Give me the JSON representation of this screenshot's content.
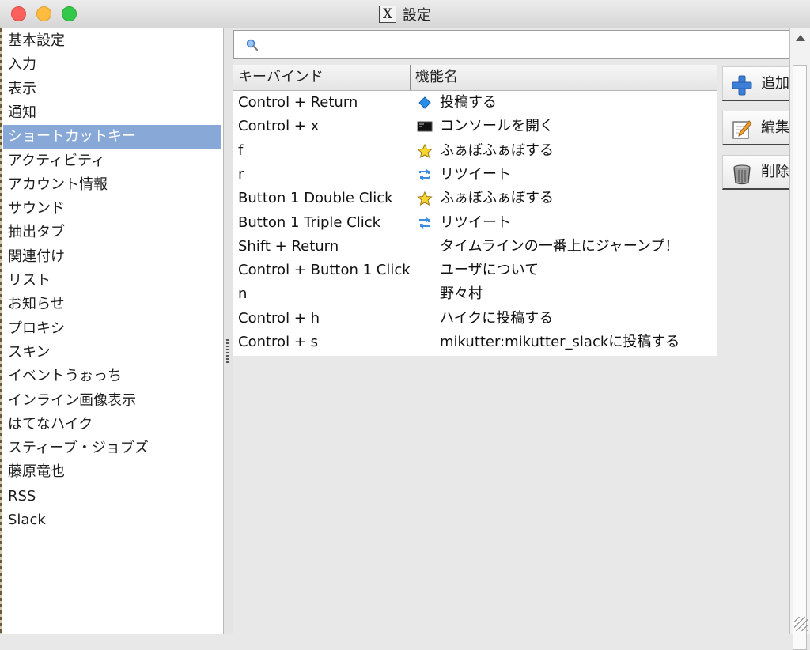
{
  "window": {
    "title": "設定"
  },
  "sidebar": {
    "items": [
      {
        "label": "基本設定"
      },
      {
        "label": "入力"
      },
      {
        "label": "表示"
      },
      {
        "label": "通知"
      },
      {
        "label": "ショートカットキー",
        "selected": true
      },
      {
        "label": "アクティビティ"
      },
      {
        "label": "アカウント情報"
      },
      {
        "label": "サウンド"
      },
      {
        "label": "抽出タブ"
      },
      {
        "label": "関連付け"
      },
      {
        "label": "リスト"
      },
      {
        "label": "お知らせ"
      },
      {
        "label": "プロキシ"
      },
      {
        "label": "スキン"
      },
      {
        "label": "イベントうぉっち"
      },
      {
        "label": "インライン画像表示"
      },
      {
        "label": "はてなハイク"
      },
      {
        "label": "スティーブ・ジョブズ"
      },
      {
        "label": "藤原竜也"
      },
      {
        "label": "RSS"
      },
      {
        "label": "Slack"
      }
    ]
  },
  "search": {
    "value": "",
    "icon": "search-icon"
  },
  "table": {
    "columns": [
      "キーバインド",
      "機能名"
    ],
    "rows": [
      {
        "key": "Control + Return",
        "func": "投稿する",
        "icon": "post"
      },
      {
        "key": "Control + x",
        "func": "コンソールを開く",
        "icon": "console"
      },
      {
        "key": "f",
        "func": "ふぁぼふぁぼする",
        "icon": "star"
      },
      {
        "key": "r",
        "func": "リツイート",
        "icon": "retweet"
      },
      {
        "key": "Button 1 Double Click",
        "func": "ふぁぼふぁぼする",
        "icon": "star"
      },
      {
        "key": "Button 1 Triple Click",
        "func": "リツイート",
        "icon": "retweet"
      },
      {
        "key": "Shift + Return",
        "func": "タイムラインの一番上にジャーンプ！",
        "icon": ""
      },
      {
        "key": "Control + Button 1 Click",
        "func": "ユーザについて",
        "icon": ""
      },
      {
        "key": "n",
        "func": "野々村",
        "icon": ""
      },
      {
        "key": "Control + h",
        "func": "ハイクに投稿する",
        "icon": ""
      },
      {
        "key": "Control + s",
        "func": "mikutter:mikutter_slackに投稿する",
        "icon": ""
      }
    ]
  },
  "actions": {
    "add_label": "追加",
    "edit_label": "編集",
    "delete_label": "削除"
  },
  "colors": {
    "selection": "#88a8d8",
    "accent_blue": "#3d7fd6"
  }
}
